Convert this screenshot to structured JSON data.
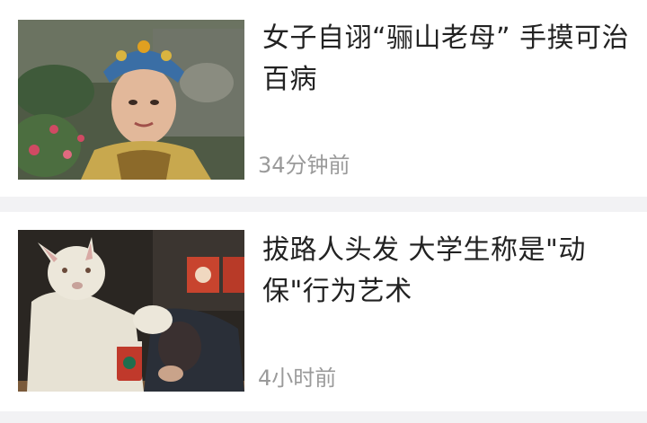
{
  "feed": {
    "items": [
      {
        "title": "女子自诩“骊山老母” 手摸可治百病",
        "time": "34分钟前",
        "image_icon": "opera-costume-woman-photo"
      },
      {
        "title": "拔路人头发 大学生称是\"动保\"行为艺术",
        "time": "4小时前",
        "image_icon": "rabbit-mask-person-photo"
      }
    ]
  }
}
